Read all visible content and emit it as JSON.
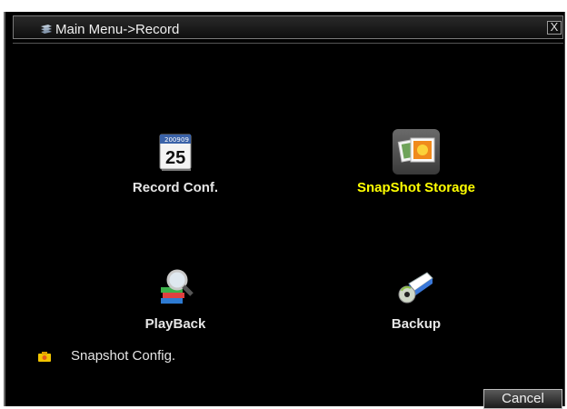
{
  "window": {
    "title": "Main Menu->Record",
    "close_label": "X"
  },
  "menu": {
    "items": [
      {
        "label": "Record Conf.",
        "icon": "calendar-icon",
        "calendar_year": "2009",
        "calendar_month": "09",
        "calendar_day": "25"
      },
      {
        "label": "SnapShot Storage",
        "icon": "photo-icon",
        "selected": true
      },
      {
        "label": "PlayBack",
        "icon": "magnifier-books-icon"
      },
      {
        "label": "Backup",
        "icon": "disc-drive-icon"
      }
    ]
  },
  "snapshot_config": {
    "label": "Snapshot Config."
  },
  "footer": {
    "cancel_label": "Cancel"
  },
  "colors": {
    "selected_text": "#ffff00",
    "normal_text": "#e6e6e6",
    "background": "#000000"
  }
}
